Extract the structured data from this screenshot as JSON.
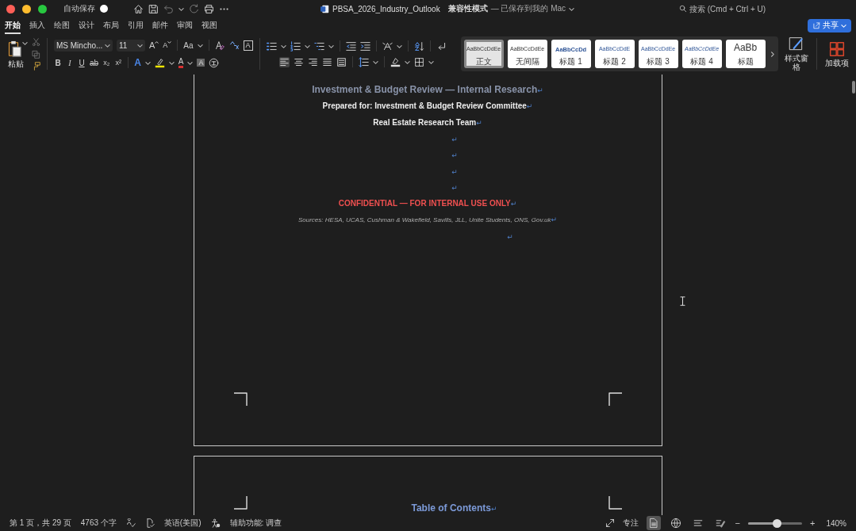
{
  "title_bar": {
    "autosave_label": "自动保存",
    "autosave_on": false,
    "document_title": "PBSA_2026_Industry_Outlook",
    "mode": "兼容性模式",
    "save_state": "— 已保存到我的 Mac",
    "search_placeholder": "搜索 (Cmd + Ctrl + U)"
  },
  "tabs": [
    {
      "label": "开始",
      "selected": true
    },
    {
      "label": "插入",
      "selected": false
    },
    {
      "label": "绘图",
      "selected": false
    },
    {
      "label": "设计",
      "selected": false
    },
    {
      "label": "布局",
      "selected": false
    },
    {
      "label": "引用",
      "selected": false
    },
    {
      "label": "邮件",
      "selected": false
    },
    {
      "label": "审阅",
      "selected": false
    },
    {
      "label": "视图",
      "selected": false
    }
  ],
  "share_button": "共享",
  "ribbon": {
    "paste_label": "粘贴",
    "font": {
      "name": "MS Mincho...",
      "size": "11",
      "grow": "A",
      "shrink": "A",
      "change_case": "Aa",
      "border_letter": "A",
      "effect_letter": "A",
      "color_letter": "A",
      "shading_letter": "A"
    },
    "format_buttons": [
      {
        "label": "B",
        "kind": "bold"
      },
      {
        "label": "I",
        "kind": "italic"
      },
      {
        "label": "U",
        "kind": "underline"
      },
      {
        "label": "ab",
        "kind": "strike"
      },
      {
        "label": "x₂",
        "kind": "sub"
      },
      {
        "label": "x²",
        "kind": "sup"
      }
    ],
    "alignments": [
      {
        "kind": "left",
        "selected": true
      },
      {
        "kind": "center",
        "selected": false
      },
      {
        "kind": "right",
        "selected": false
      },
      {
        "kind": "justify",
        "selected": false
      },
      {
        "kind": "distributed",
        "selected": false
      }
    ],
    "styles": [
      {
        "preview": "AaBbCcDdEe",
        "label": "正文",
        "kind": "normal",
        "selected": true
      },
      {
        "preview": "AaBbCcDdEe",
        "label": "无间隔",
        "kind": "plain",
        "selected": false
      },
      {
        "preview": "AaBbCcDd",
        "label": "标题 1",
        "kind": "heading1",
        "selected": false
      },
      {
        "preview": "AaBbCcDdE",
        "label": "标题 2",
        "kind": "heading",
        "selected": false
      },
      {
        "preview": "AaBbCcDdEe",
        "label": "标题 3",
        "kind": "heading_small",
        "selected": false
      },
      {
        "preview": "AaBbCcDdEe",
        "label": "标题 4",
        "kind": "heading_italic",
        "selected": false
      },
      {
        "preview": "AaBb",
        "label": "标题",
        "kind": "title",
        "selected": false
      }
    ],
    "styles_pane_label": "样式窗格",
    "addins_label": "加载项"
  },
  "document": {
    "pages": [
      {
        "paragraphs": [
          {
            "kind": "title",
            "text": "Investment & Budget Review — Internal Research",
            "mark": "↵"
          },
          {
            "kind": "bold",
            "text": "Prepared for: Investment & Budget Review Committee",
            "mark": "↵"
          },
          {
            "kind": "bold",
            "text": "Real Estate Research Team",
            "mark": "↵"
          },
          {
            "kind": "empty",
            "mark": "↵"
          },
          {
            "kind": "empty",
            "mark": "↵"
          },
          {
            "kind": "empty",
            "mark": "↵"
          },
          {
            "kind": "empty",
            "mark": "↵"
          },
          {
            "kind": "confidential",
            "text": "CONFIDENTIAL — FOR INTERNAL USE ONLY",
            "mark": "↵"
          },
          {
            "kind": "sources",
            "text": "Sources: HESA, UCAS, Cushman & Wakefield, Savills, JLL, Unite Students, ONS, Gov.uk",
            "mark": "↵"
          },
          {
            "kind": "empty_indent",
            "mark": "↵"
          }
        ]
      },
      {
        "paragraphs": [
          {
            "kind": "heading",
            "text": "Table of Contents",
            "mark": "↵"
          }
        ]
      }
    ]
  },
  "status_bar": {
    "page": "第 1 页，共 29 页",
    "words": "4763 个字",
    "language": "英语(美国)",
    "accessibility": "辅助功能: 调查",
    "focus": "专注",
    "views": [
      {
        "kind": "print",
        "selected": true
      },
      {
        "kind": "web",
        "selected": false
      },
      {
        "kind": "outline",
        "selected": false
      },
      {
        "kind": "draft",
        "selected": false
      }
    ],
    "zoom_minus": "−",
    "zoom_plus": "+",
    "zoom": {
      "label": "140%",
      "level": 0.53
    }
  }
}
